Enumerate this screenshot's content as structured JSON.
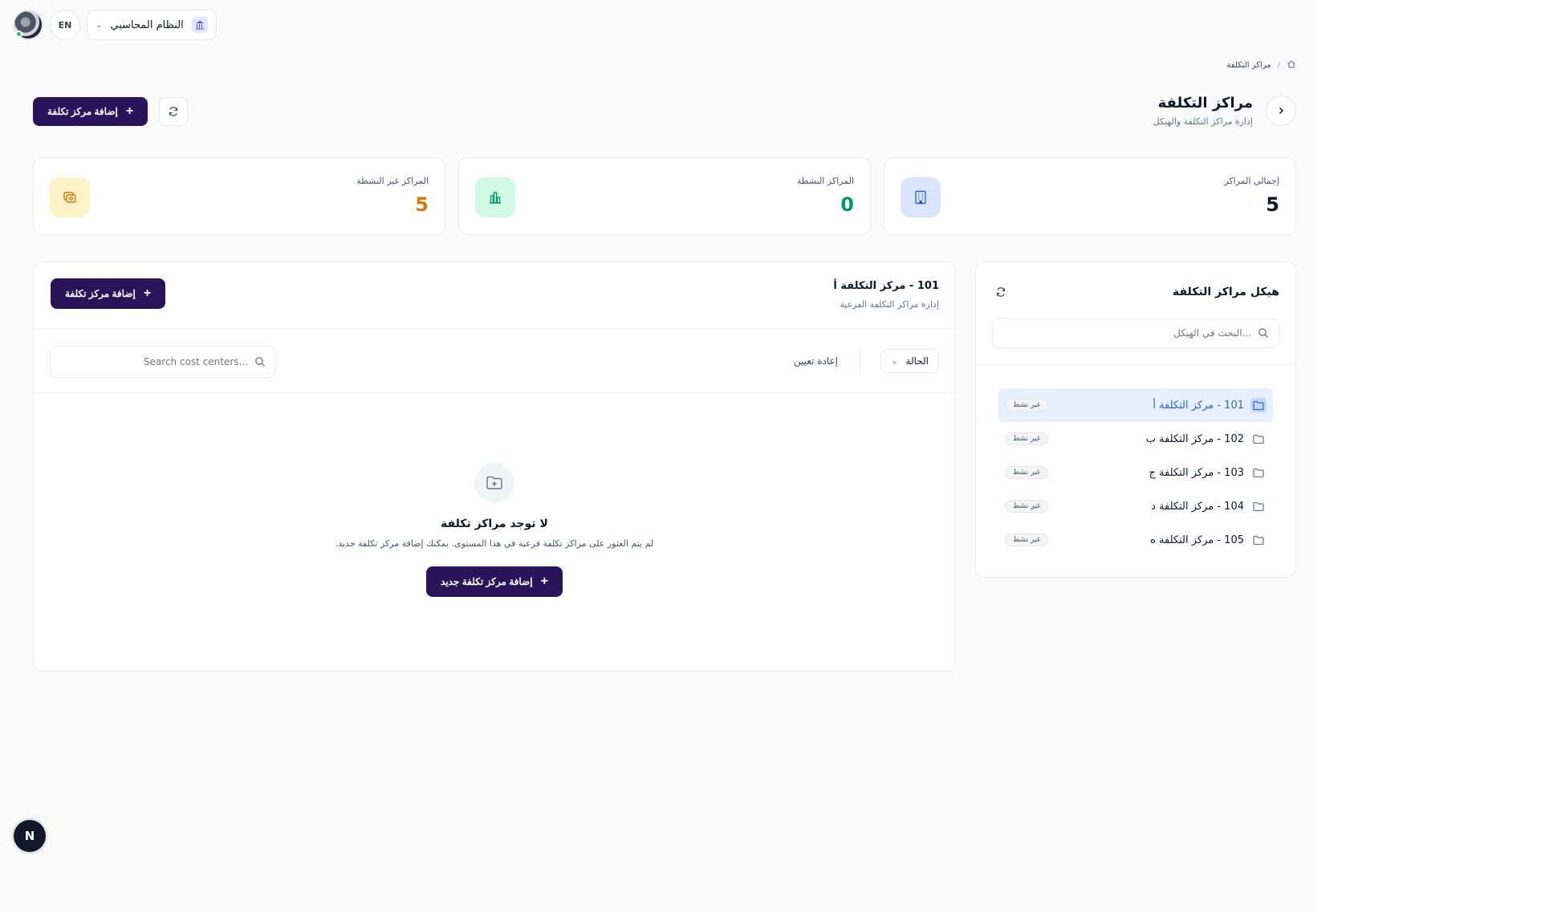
{
  "topbar": {
    "language": "EN",
    "system": "النظام المحاسبي"
  },
  "breadcrumb": {
    "current": "مراكز التكلفة"
  },
  "header": {
    "title": "مراكز التكلفة",
    "subtitle": "إدارة مراكز التكلفة والهيكل",
    "add_button": "إضافة مركز تكلفة"
  },
  "stats": [
    {
      "label": "إجمالي المراكز",
      "value": "5",
      "color": "#111827",
      "icon": "building-icon",
      "icon_bg": "#dbe5fd",
      "icon_color": "#2563eb"
    },
    {
      "label": "المراكز النشطة",
      "value": "0",
      "color": "#059669",
      "icon": "bar-chart-icon",
      "icon_bg": "#d1fae5",
      "icon_color": "#059669"
    },
    {
      "label": "المراكز غير النشطة",
      "value": "5",
      "color": "#d97706",
      "icon": "archive-icon",
      "icon_bg": "#fef3c7",
      "icon_color": "#d97706"
    }
  ],
  "tree": {
    "title": "هيكل مراكز التكلفة",
    "search_placeholder": "البحث في الهيكل...",
    "items": [
      {
        "label": "101 - مركز التكلفة أ",
        "status": "غير نشط"
      },
      {
        "label": "102 - مركز التكلفة ب",
        "status": "غير نشط"
      },
      {
        "label": "103 - مركز التكلفة ج",
        "status": "غير نشط"
      },
      {
        "label": "104 - مركز التكلفة د",
        "status": "غير نشط"
      },
      {
        "label": "105 - مركز التكلفة ه",
        "status": "غير نشط"
      }
    ]
  },
  "detail": {
    "title": "101 - مركز التكلفة أ",
    "subtitle": "إدارة مراكز التكلفة الفرعية",
    "add_button": "إضافة مركز تكلفة",
    "status_filter": "الحالة",
    "reset": "إعادة تعيين",
    "search_placeholder": "Search cost centers...",
    "empty_title": "لا توجد مراكز تكلفة",
    "empty_desc": "لم يتم العثور على مراكز تكلفة فرعية في هذا المستوى. يمكنك إضافة مركز تكلفة جديد.",
    "empty_button": "إضافة مركز تكلفة جديد"
  },
  "fab": "N"
}
